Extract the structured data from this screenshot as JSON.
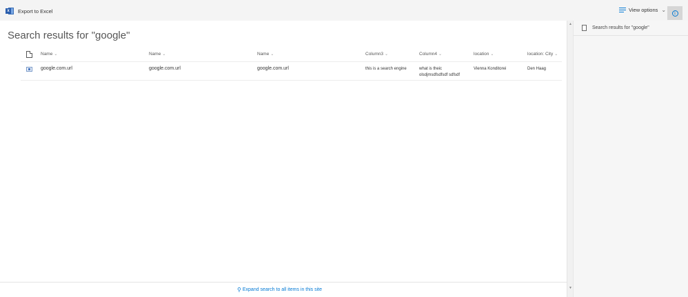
{
  "toolbar": {
    "export_label": "Export to Excel",
    "view_options_label": "View options"
  },
  "page": {
    "title": "Search results for \"google\""
  },
  "columns": [
    {
      "label": "Name"
    },
    {
      "label": "Name"
    },
    {
      "label": "Name"
    },
    {
      "label": "Column3"
    },
    {
      "label": "Column4"
    },
    {
      "label": "location"
    },
    {
      "label": "location: City"
    }
  ],
  "rows": [
    {
      "name1": "google.com.url",
      "name2": "google.com.url",
      "name3": "google.com.url",
      "column3": "this is a search engine",
      "column4_line1": "what is theic",
      "column4_line2": "olsdjmsdfsdfsdf sdfsdf",
      "location": "Vienna Konditorei",
      "city": "Den Haag"
    }
  ],
  "footer": {
    "expand_label": "Expand search to all items in this site"
  },
  "side_panel": {
    "title": "Search results for \"google\""
  },
  "colors": {
    "accent": "#0078d4",
    "command_bar_bg": "#f4f4f4",
    "side_panel_bg": "#f6f6f6"
  },
  "icons": {
    "export": "excel-icon",
    "view_options": "lines-icon",
    "info": "info-icon",
    "header_doc": "document-icon",
    "row": "url-file-icon",
    "expand": "search-icon"
  }
}
